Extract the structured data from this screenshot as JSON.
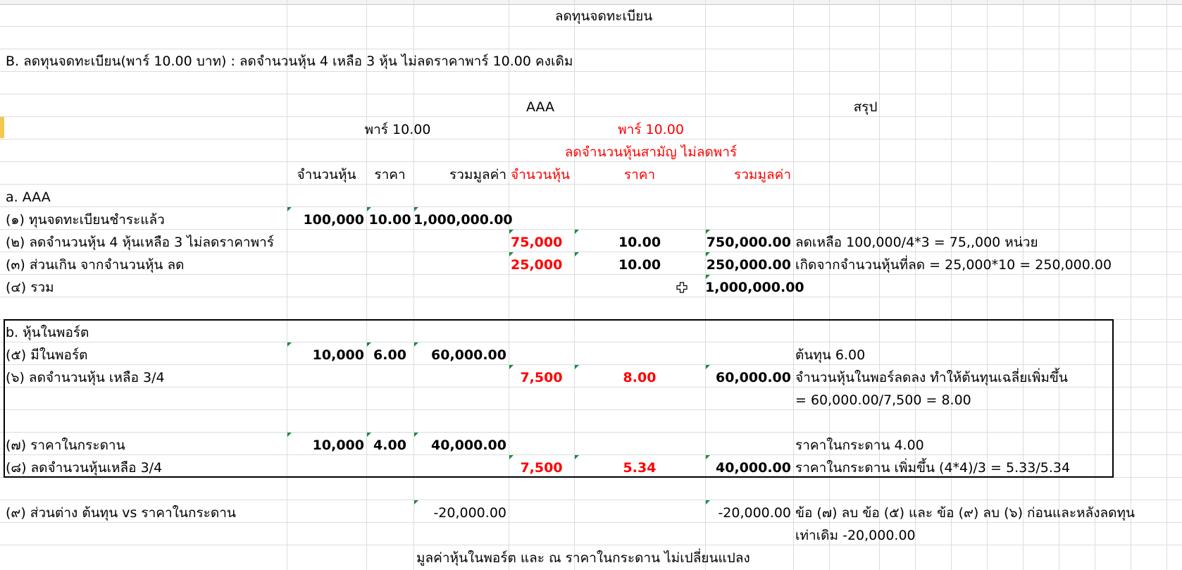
{
  "title": "ลดทุนจดทะเบียน",
  "subtitle": "B. ลดทุนจดทะเบียน(พาร์ 10.00 บาท) :   ลดจำนวนหุ้น 4 เหลือ 3 หุ้น ไม่ลดราคาพาร์ 10.00 คงเดิม",
  "headers": {
    "aaa": "AAA",
    "summary": "สรุป",
    "par_left": "พาร์ 10.00",
    "par_right": "พาร์ 10.00",
    "reduce_note": "ลดจำนวนหุ้นสามัญ ไม่ลดพาร์",
    "col_shares": "จำนวนหุ้น",
    "col_price": "ราคา",
    "col_total": "รวมมูลค่า",
    "col_shares_r": "จำนวนหุ้น",
    "col_price_r": "ราคา",
    "col_total_r": "รวมมูลค่า"
  },
  "section_a": "a. AAA",
  "rows": [
    {
      "label": "(๑) ทุนจดทะเบียนชำระแล้ว",
      "shares": "100,000",
      "price": "10.00",
      "total": "1,000,000.00",
      "shares_r": "",
      "price_r": "",
      "total_r": "",
      "note": ""
    },
    {
      "label": "(๒) ลดจำนวนหุ้น 4 หุ้นเหลือ 3 ไม่ลดราคาพาร์",
      "shares": "",
      "price": "",
      "total": "",
      "shares_r": "75,000",
      "price_r": "10.00",
      "total_r": "750,000.00",
      "note": "ลดเหลือ 100,000/4*3 = 75,,000 หน่วย"
    },
    {
      "label": "(๓) ส่วนเกิน จากจำนวนหุ้น ลด",
      "shares": "",
      "price": "",
      "total": "",
      "shares_r": "25,000",
      "price_r": "10.00",
      "total_r": "250,000.00",
      "note": "เกิดจากจำนวนหุ้นที่ลด = 25,000*10 = 250,000.00"
    },
    {
      "label": "(๔) รวม",
      "shares": "",
      "price": "",
      "total": "",
      "shares_r": "",
      "price_r": "",
      "total_r": "1,000,000.00",
      "note": ""
    }
  ],
  "section_b": "b. หุ้นในพอร์ต",
  "rows_b": [
    {
      "label": "(๕) มีในพอร์ต",
      "shares": "10,000",
      "price": "6.00",
      "total": "60,000.00",
      "shares_r": "",
      "price_r": "",
      "total_r": "",
      "note": "ต้นทุน 6.00"
    },
    {
      "label": "(๖) ลดจำนวนหุ้น เหลือ 3/4",
      "shares": "",
      "price": "",
      "total": "",
      "shares_r": "7,500",
      "price_r": "8.00",
      "total_r": "60,000.00",
      "note": "จำนวนหุ้นในพอร์ลดลง ทำให้ต้นทุนเฉลี่ยเพิ่มขึ้น"
    },
    {
      "label": "",
      "shares": "",
      "price": "",
      "total": "",
      "shares_r": "",
      "price_r": "",
      "total_r": "",
      "note": "= 60,000.00/7,500 = 8.00"
    },
    {
      "label": "(๗) ราคาในกระดาน",
      "shares": "10,000",
      "price": "4.00",
      "total": "40,000.00",
      "shares_r": "",
      "price_r": "",
      "total_r": "",
      "note": "ราคาในกระดาน 4.00"
    },
    {
      "label": "(๘) ลดจำนวนหุ้นเหลือ 3/4",
      "shares": "",
      "price": "",
      "total": "",
      "shares_r": "7,500",
      "price_r": "5.34",
      "total_r": "40,000.00",
      "note": "ราคาในกระดาน เพิ่มขึ้น (4*4)/3 = 5.33/5.34"
    }
  ],
  "row9": {
    "label": "(๙) ส่วนต่าง ต้นทุน vs ราคาในกระดาน",
    "total": "-20,000.00",
    "total_r": "-20,000.00",
    "note": "ข้อ (๗) ลบ ข้อ (๕) และ ข้อ (๙) ลบ (๖) ก่อนและหลังลดทุน",
    "note2": "เท่าเดิม -20,000.00"
  },
  "footer": "มูลค่าหุ้นในพอร์ต และ ณ ราคาในกระดาน ไม่เปลี่ยนแปลง"
}
